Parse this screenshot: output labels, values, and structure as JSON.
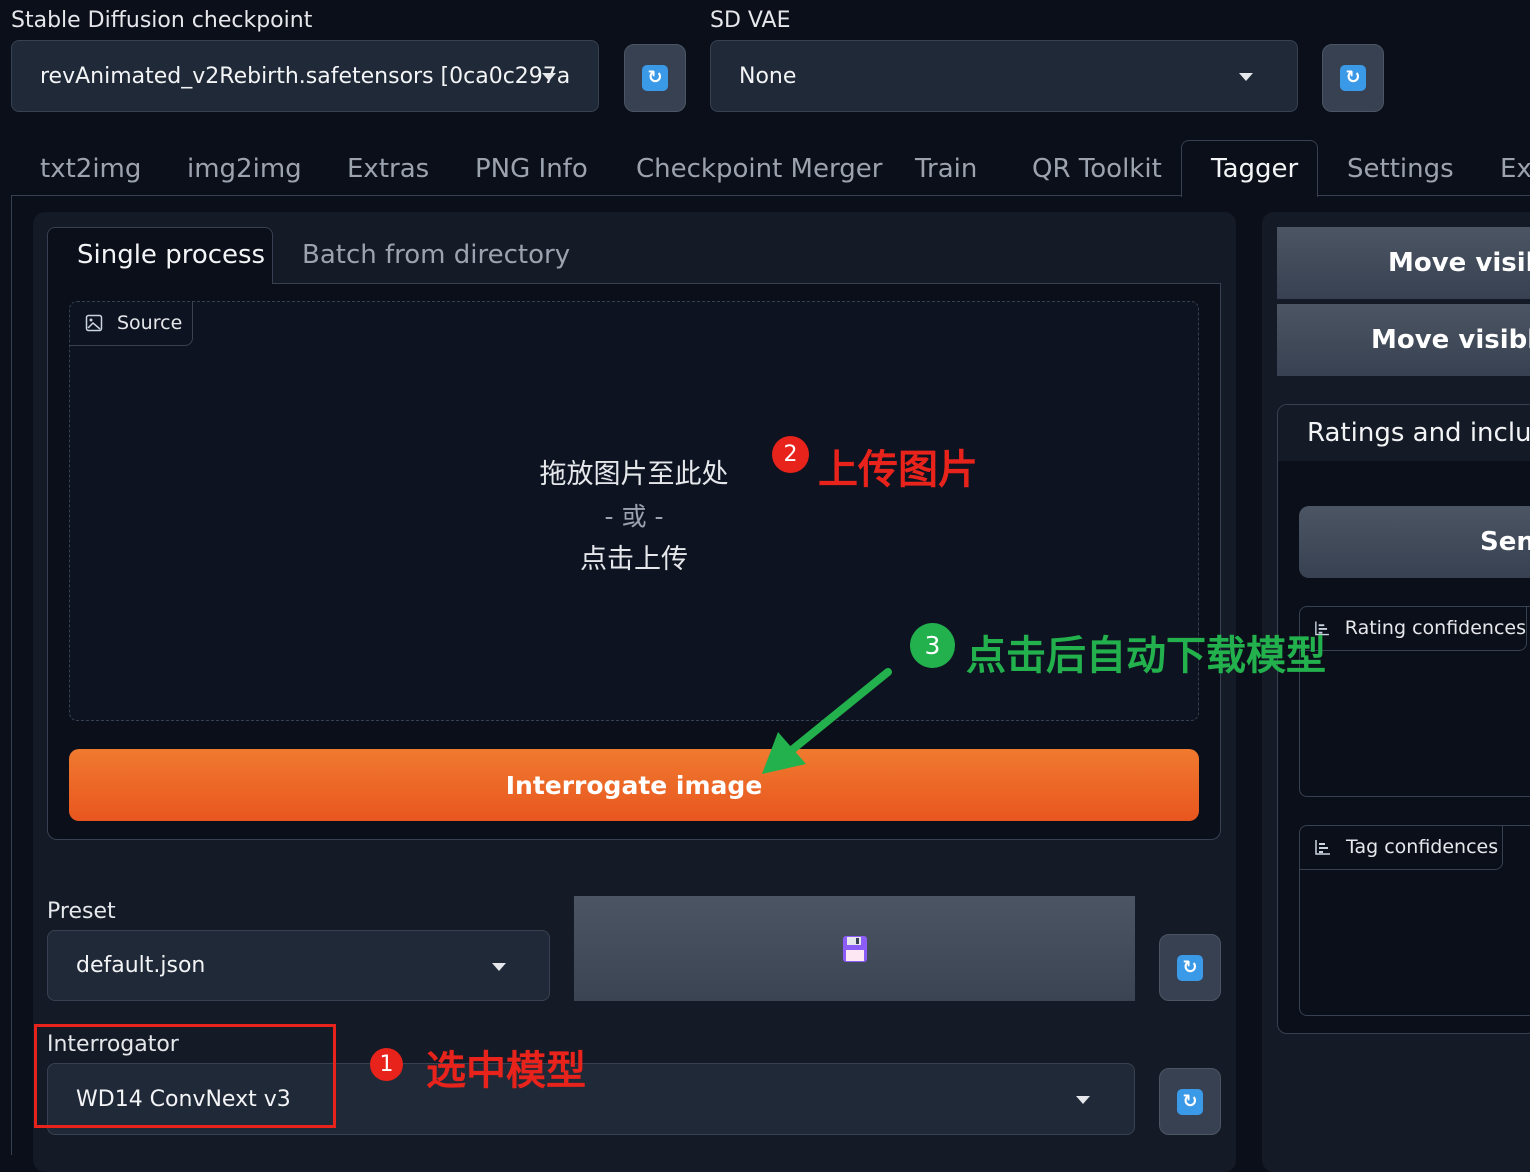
{
  "top": {
    "checkpoint_label": "Stable Diffusion checkpoint",
    "checkpoint_value": "revAnimated_v2Rebirth.safetensors [0ca0c297a",
    "vae_label": "SD VAE",
    "vae_value": "None"
  },
  "tabs": [
    "txt2img",
    "img2img",
    "Extras",
    "PNG Info",
    "Checkpoint Merger",
    "Train",
    "QR Toolkit",
    "Tagger",
    "Settings",
    "Ext"
  ],
  "active_tab": "Tagger",
  "subtabs": [
    "Single process",
    "Batch from directory"
  ],
  "source": {
    "label": "Source",
    "drop_text": "拖放图片至此处",
    "or_text": "- 或 -",
    "click_text": "点击上传"
  },
  "interrogate_label": "Interrogate image",
  "preset": {
    "label": "Preset",
    "value": "default.json"
  },
  "interrogator": {
    "label": "Interrogator",
    "value": "WD14 ConvNext v3"
  },
  "right": {
    "move_visible_1": "Move visible",
    "move_visible_2": "Move visible t",
    "ratings_label": "Ratings and include",
    "send_label": "Send",
    "rating_conf_label": "Rating confidences",
    "tag_conf_label": "Tag confidences"
  },
  "annotations": {
    "a1_num": "1",
    "a1_text": "选中模型",
    "a2_num": "2",
    "a2_text": "上传图片",
    "a3_num": "3",
    "a3_text": "点击后自动下载模型"
  },
  "colors": {
    "accent_orange": "#ec6a2a",
    "annotation_red": "#e8231b",
    "annotation_green": "#22b14c"
  }
}
